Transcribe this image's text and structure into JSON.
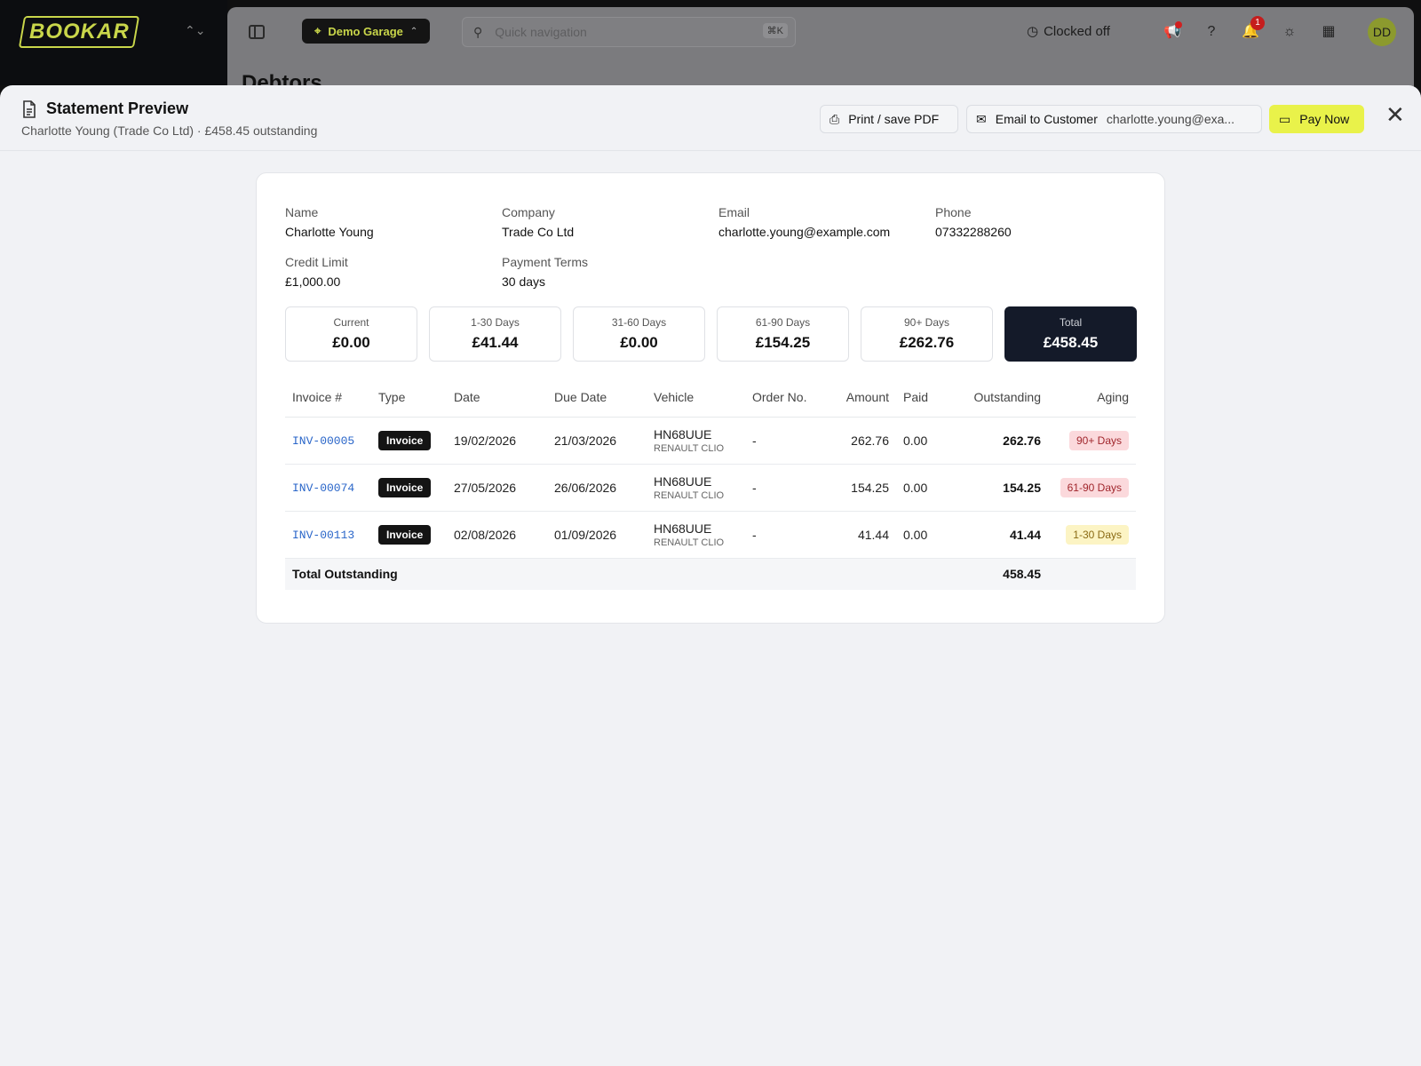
{
  "app": {
    "logo_text": "BOOKAR",
    "garage_name": "Demo Garage",
    "quick_nav_placeholder": "Quick navigation",
    "quick_nav_shortcut": "⌘K",
    "clock_status": "Clocked off",
    "notification_count": "1",
    "avatar_initials": "DD",
    "background_page_title": "Debtors"
  },
  "sheet": {
    "title": "Statement Preview",
    "subtitle": "Charlotte Young (Trade Co Ltd) · £458.45 outstanding",
    "print_label": "Print / save PDF",
    "email_label": "Email to Customer",
    "email_address": "charlotte.young@exa...",
    "pay_label": "Pay Now"
  },
  "customer": {
    "name_label": "Name",
    "name": "Charlotte Young",
    "company_label": "Company",
    "company": "Trade Co Ltd",
    "email_label": "Email",
    "email": "charlotte.young@example.com",
    "phone_label": "Phone",
    "phone": "07332288260",
    "credit_limit_label": "Credit Limit",
    "credit_limit": "£1,000.00",
    "payment_terms_label": "Payment Terms",
    "payment_terms": "30 days"
  },
  "aging_summary": [
    {
      "label": "Current",
      "value": "£0.00"
    },
    {
      "label": "1-30 Days",
      "value": "£41.44"
    },
    {
      "label": "31-60 Days",
      "value": "£0.00"
    },
    {
      "label": "61-90 Days",
      "value": "£154.25"
    },
    {
      "label": "90+ Days",
      "value": "£262.76"
    },
    {
      "label": "Total",
      "value": "£458.45"
    }
  ],
  "table": {
    "headers": [
      "Invoice #",
      "Type",
      "Date",
      "Due Date",
      "Vehicle",
      "Order No.",
      "Amount",
      "Paid",
      "Outstanding",
      "Aging"
    ],
    "rows": [
      {
        "invoice": "INV-00005",
        "type": "Invoice",
        "date": "19/02/2026",
        "due": "21/03/2026",
        "reg": "HN68UUE",
        "model": "RENAULT CLIO",
        "order": "-",
        "amount": "262.76",
        "paid": "0.00",
        "outstanding": "262.76",
        "aging": "90+ Days"
      },
      {
        "invoice": "INV-00074",
        "type": "Invoice",
        "date": "27/05/2026",
        "due": "26/06/2026",
        "reg": "HN68UUE",
        "model": "RENAULT CLIO",
        "order": "-",
        "amount": "154.25",
        "paid": "0.00",
        "outstanding": "154.25",
        "aging": "61-90 Days"
      },
      {
        "invoice": "INV-00113",
        "type": "Invoice",
        "date": "02/08/2026",
        "due": "01/09/2026",
        "reg": "HN68UUE",
        "model": "RENAULT CLIO",
        "order": "-",
        "amount": "41.44",
        "paid": "0.00",
        "outstanding": "41.44",
        "aging": "1-30 Days"
      }
    ],
    "total_label": "Total Outstanding",
    "total_value": "458.45"
  },
  "colors": {
    "accent_yellow": "#e9f24a",
    "logo_green": "#c9d64a",
    "total_box": "#141a29",
    "link_blue": "#2a66c9"
  }
}
